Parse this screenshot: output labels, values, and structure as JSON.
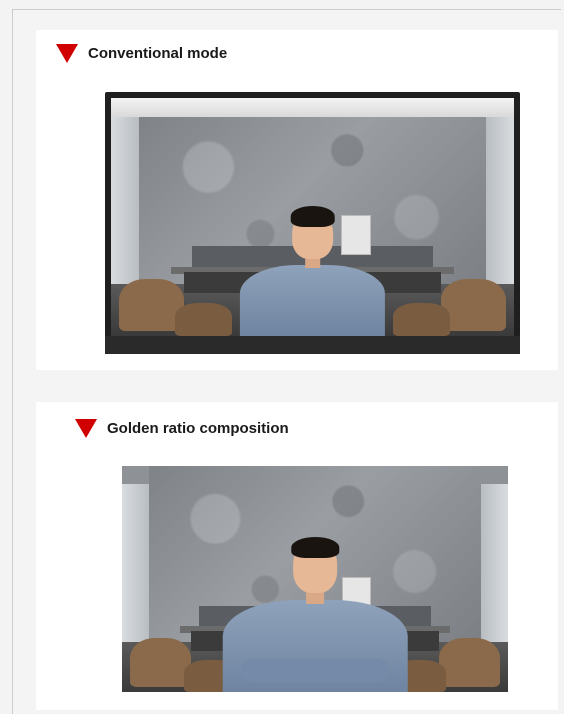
{
  "sections": [
    {
      "title": "Conventional mode",
      "image_desc": "monitor-scene"
    },
    {
      "title": "Golden ratio composition",
      "image_desc": "closeup-scene"
    }
  ],
  "colors": {
    "accent": "#d00000"
  },
  "icons": {
    "bullet": "red-triangle-icon"
  }
}
